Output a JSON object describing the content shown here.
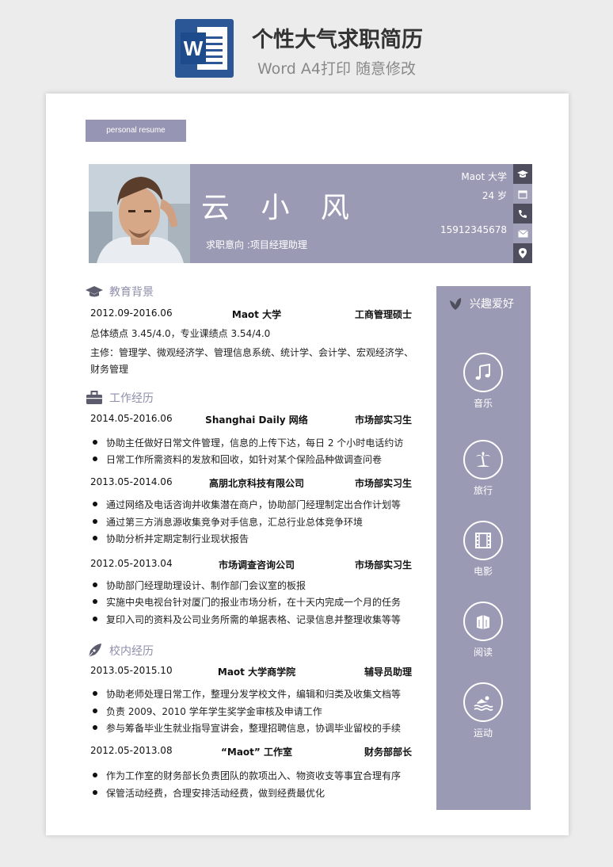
{
  "banner": {
    "title": "个性大气求职简历",
    "subtitle": "Word A4打印 随意修改",
    "word_letter": "W"
  },
  "resume": {
    "tag": "personal resume",
    "name": "云 小 风",
    "intent": "求职意向 :项目经理助理",
    "school": "Maot 大学",
    "age": "24 岁",
    "phone": "15912345678"
  },
  "sections": {
    "education": "教育背景",
    "work": "工作经历",
    "campus": "校内经历",
    "hobbies": "兴趣爱好"
  },
  "education": {
    "date": "2012.09-2016.06",
    "school": "Maot 大学",
    "degree": "工商管理硕士",
    "gpa": "总体绩点   3.45/4.0，专业课绩点   3.54/4.0",
    "courses_1": "主修：管理学、微观经济学、管理信息系统、统计学、会计学、宏观经济学、",
    "courses_2": "财务管理"
  },
  "work": [
    {
      "date": "2014.05-2016.06",
      "org": "Shanghai Daily 网络",
      "role": "市场部实习生",
      "bullets": [
        "协助主任做好日常文件管理，信息的上传下达，每日 2 个小时电话约访",
        "日常工作所需资料的发放和回收，如针对某个保险品种做调查问卷"
      ]
    },
    {
      "date": "2013.05-2014.06",
      "org": "高朋北京科技有限公司",
      "role": "市场部实习生",
      "bullets": [
        "通过网络及电话咨询并收集潜在商户，协助部门经理制定出合作计划等",
        "通过第三方消息源收集竞争对手信息，汇总行业总体竞争环境",
        "协助分析并定期定制行业现状报告"
      ]
    },
    {
      "date": "2012.05-2013.04",
      "org": "市场调查咨询公司",
      "role": "市场部实习生",
      "bullets": [
        "协助部门经理助理设计、制作部门会议室的板报",
        "实施中央电视台针对厦门的报业市场分析，在十天内完成一个月的任务",
        "复印入司的资料及公司业务所需的单据表格、记录信息并整理收集等等"
      ]
    }
  ],
  "campus": [
    {
      "date": "2013.05-2015.10",
      "org": "Maot 大学商学院",
      "role": "辅导员助理",
      "bullets": [
        "协助老师处理日常工作，整理分发学校文件，编辑和归类及收集文档等",
        "负责 2009、2010 学年学生奖学金审核及申请工作",
        "参与筹备毕业生就业指导宣讲会，整理招聘信息，协调毕业留校的手续"
      ]
    },
    {
      "date": "2012.05-2013.08",
      "org": "“Maot” 工作室",
      "role": "财务部部长",
      "bullets": [
        "作为工作室的财务部长负责团队的款项出入、物资收支等事宜合理有序",
        "保管活动经费，合理安排活动经费，做到经费最优化"
      ]
    }
  ],
  "hobbies": [
    {
      "label": "音乐",
      "icon": "music-note-icon"
    },
    {
      "label": "旅行",
      "icon": "palm-tree-icon"
    },
    {
      "label": "电影",
      "icon": "film-icon"
    },
    {
      "label": "阅读",
      "icon": "books-icon"
    },
    {
      "label": "运动",
      "icon": "swimming-icon"
    }
  ],
  "colors": {
    "accent": "#9a9ab4",
    "icon_dark": "#4e4e5e",
    "word_blue": "#2b5797"
  }
}
